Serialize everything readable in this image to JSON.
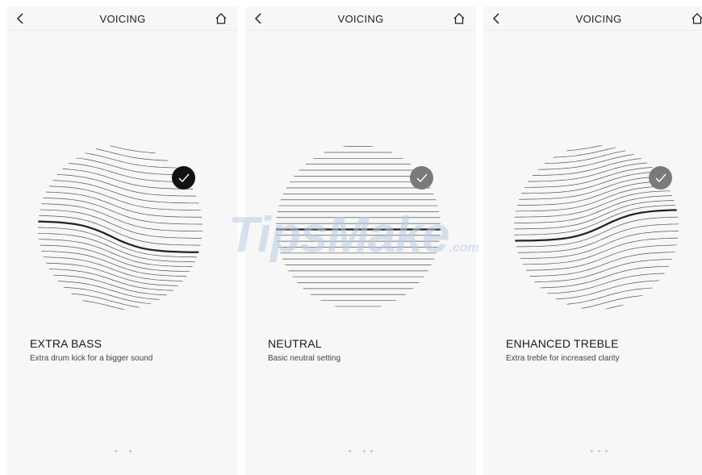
{
  "screens": [
    {
      "title": "VOICING",
      "preset_name": "EXTRA BASS",
      "preset_description": "Extra drum kick for a bigger sound",
      "selected": true
    },
    {
      "title": "VOICING",
      "preset_name": "NEUTRAL",
      "preset_description": "Basic neutral setting",
      "selected": false
    },
    {
      "title": "VOICING",
      "preset_name": "ENHANCED TREBLE",
      "preset_description": "Extra treble for increased clarity",
      "selected": false
    }
  ],
  "icons": {
    "back": "chevron-left-icon",
    "home": "home-icon",
    "check": "checkmark-icon"
  },
  "colors": {
    "background": "#f7f7f7",
    "selected_check": "#111111",
    "unselected_check": "#7a7a7a",
    "text": "#1a1a1a"
  },
  "watermark": {
    "brand": "TipsMake",
    "suffix": ".com"
  }
}
